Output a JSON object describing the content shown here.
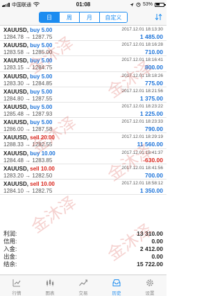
{
  "status_bar": {
    "carrier": "中国联通",
    "time": "01:08",
    "battery": "53%",
    "battery_level": 0.53
  },
  "toolbar": {
    "tabs": [
      {
        "label": "日",
        "active": true
      },
      {
        "label": "周",
        "active": false
      },
      {
        "label": "月",
        "active": false
      },
      {
        "label": "自定义",
        "active": false
      }
    ],
    "sort_icon": "sort-icon"
  },
  "trades": [
    {
      "symbol": "XAUUSD,",
      "action": "buy 5.00",
      "side": "buy",
      "open": "1284.78",
      "close": "1287.75",
      "time": "2017.12.01 18:13:30",
      "profit": "1 485.00",
      "negative": false
    },
    {
      "symbol": "XAUUSD,",
      "action": "buy 5.00",
      "side": "buy",
      "open": "1283.58",
      "close": "1285.00",
      "time": "2017.12.01 18:16:28",
      "profit": "710.00",
      "negative": false
    },
    {
      "symbol": "XAUUSD,",
      "action": "buy 5.00",
      "side": "buy",
      "open": "1283.15",
      "close": "1284.75",
      "time": "2017.12.01 18:16:41",
      "profit": "800.00",
      "negative": false
    },
    {
      "symbol": "XAUUSD,",
      "action": "buy 5.00",
      "side": "buy",
      "open": "1283.30",
      "close": "1284.85",
      "time": "2017.12.01 18:18:26",
      "profit": "775.00",
      "negative": false
    },
    {
      "symbol": "XAUUSD,",
      "action": "buy 5.00",
      "side": "buy",
      "open": "1284.80",
      "close": "1287.55",
      "time": "2017.12.01 18:21:56",
      "profit": "1 375.00",
      "negative": false
    },
    {
      "symbol": "XAUUSD,",
      "action": "buy 5.00",
      "side": "buy",
      "open": "1285.48",
      "close": "1287.93",
      "time": "2017.12.01 18:23:22",
      "profit": "1 225.00",
      "negative": false
    },
    {
      "symbol": "XAUUSD,",
      "action": "buy 5.00",
      "side": "buy",
      "open": "1286.00",
      "close": "1287.58",
      "time": "2017.12.01 18:23:33",
      "profit": "790.00",
      "negative": false
    },
    {
      "symbol": "XAUUSD,",
      "action": "sell 20.00",
      "side": "sell",
      "open": "1288.33",
      "close": "1282.55",
      "time": "2017.12.01 18:29:19",
      "profit": "11 560.00",
      "negative": false
    },
    {
      "symbol": "XAUUSD,",
      "action": "buy 10.00",
      "side": "buy",
      "open": "1284.48",
      "close": "1283.85",
      "time": "2017.12.01 18:41:37",
      "profit": "-630.00",
      "negative": true
    },
    {
      "symbol": "XAUUSD,",
      "action": "sell 10.00",
      "side": "sell",
      "open": "1283.20",
      "close": "1282.50",
      "time": "2017.12.01 18:41:56",
      "profit": "700.00",
      "negative": false
    },
    {
      "symbol": "XAUUSD,",
      "action": "sell 10.00",
      "side": "sell",
      "open": "1284.10",
      "close": "1282.75",
      "time": "2017.12.01 18:58:12",
      "profit": "1 350.00",
      "negative": false
    }
  ],
  "summary": [
    {
      "label": "利润:",
      "value": "13 310.00"
    },
    {
      "label": "信用:",
      "value": "0.00"
    },
    {
      "label": "入金:",
      "value": "2 412.00"
    },
    {
      "label": "出金:",
      "value": "0.00"
    },
    {
      "label": "结余:",
      "value": "15 722.00"
    }
  ],
  "tabbar": [
    {
      "label": "行情",
      "icon": "quotes-icon",
      "active": false
    },
    {
      "label": "图表",
      "icon": "chart-icon",
      "active": false
    },
    {
      "label": "交易",
      "icon": "trade-icon",
      "active": false
    },
    {
      "label": "历史",
      "icon": "history-icon",
      "active": true
    },
    {
      "label": "设置",
      "icon": "settings-icon",
      "active": false
    }
  ],
  "watermark": "金沐泽",
  "colors": {
    "accent": "#1c8cf0",
    "buy": "#1c73d9",
    "sell": "#d9251c",
    "watermark": "#d23228"
  }
}
